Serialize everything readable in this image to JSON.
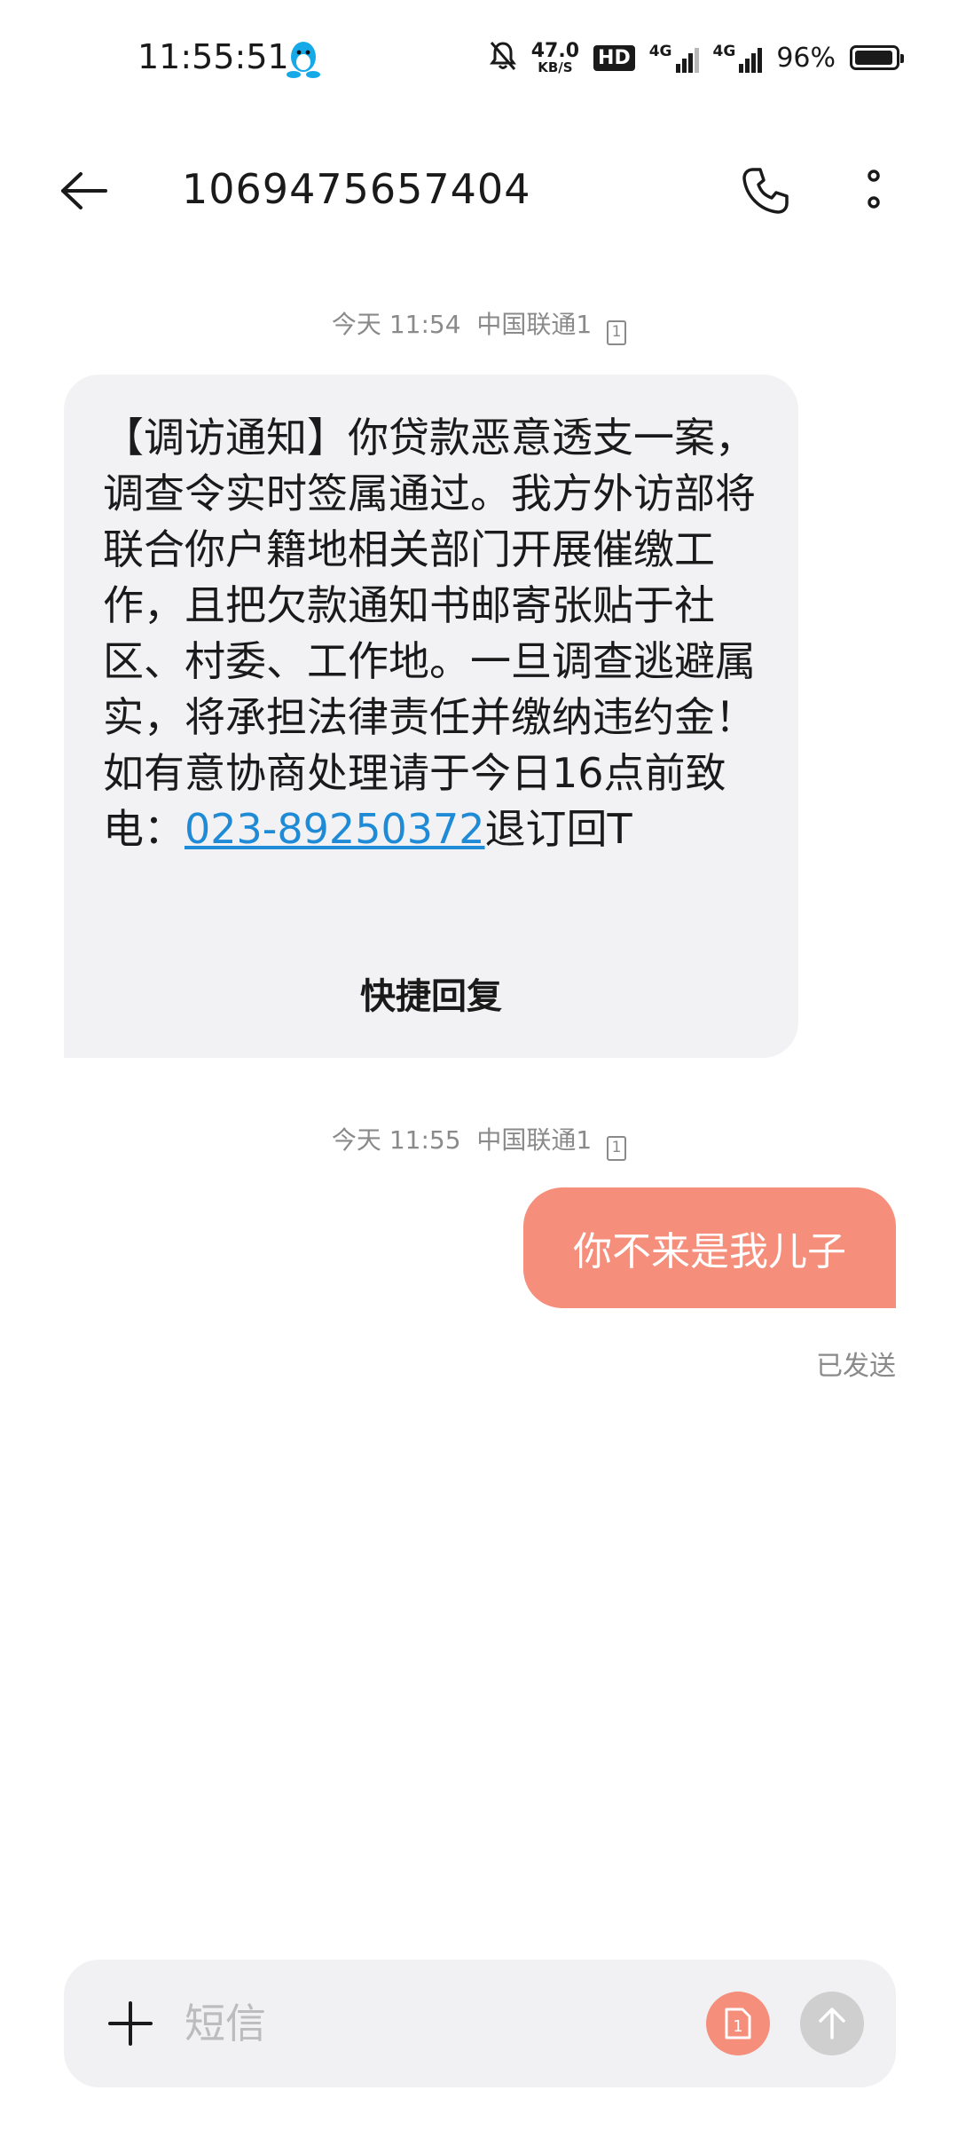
{
  "status_bar": {
    "time": "11:55:51",
    "net_speed_value": "47.0",
    "net_speed_unit": "KB/S",
    "hd_label": "HD",
    "network_1": "4G",
    "network_2": "4G",
    "battery_percent": "96%",
    "battery_level": 0.96,
    "icons": [
      "qq-penguin-icon",
      "mute-bell-icon",
      "signal-icon",
      "battery-icon"
    ]
  },
  "header": {
    "title": "1069475657404",
    "icons": [
      "back-arrow-icon",
      "phone-icon",
      "more-vertical-icon"
    ]
  },
  "messages": [
    {
      "direction": "incoming",
      "meta_time": "今天 11:54",
      "meta_carrier": "中国联通1",
      "sim_slot": "1",
      "text_before": "【调访通知】你贷款恶意透支一案，调查令实时签属通过。我方外访部将联合你户籍地相关部门开展催缴工作，且把欠款通知书邮寄张贴于社区、村委、工作地。一旦调查逃避属实，将承担法律责任并缴纳违约金！如有意协商处理请于今日16点前致电：",
      "link": "023-89250372",
      "text_after": "退订回T",
      "quick_reply_label": "快捷回复"
    },
    {
      "direction": "outgoing",
      "meta_time": "今天 11:55",
      "meta_carrier": "中国联通1",
      "sim_slot": "1",
      "text": "你不来是我儿子",
      "status": "已发送"
    }
  ],
  "composer": {
    "placeholder": "短信",
    "sim_badge": "1",
    "colors": {
      "sim_button": "#f58e7b",
      "send_button": "#cfcfcf"
    },
    "icons": [
      "plus-icon",
      "sim-card-icon",
      "send-arrow-icon"
    ]
  },
  "colors": {
    "outgoing_bubble": "#f58e7b",
    "incoming_bubble": "#f2f2f4",
    "link": "#1f8ad6"
  }
}
